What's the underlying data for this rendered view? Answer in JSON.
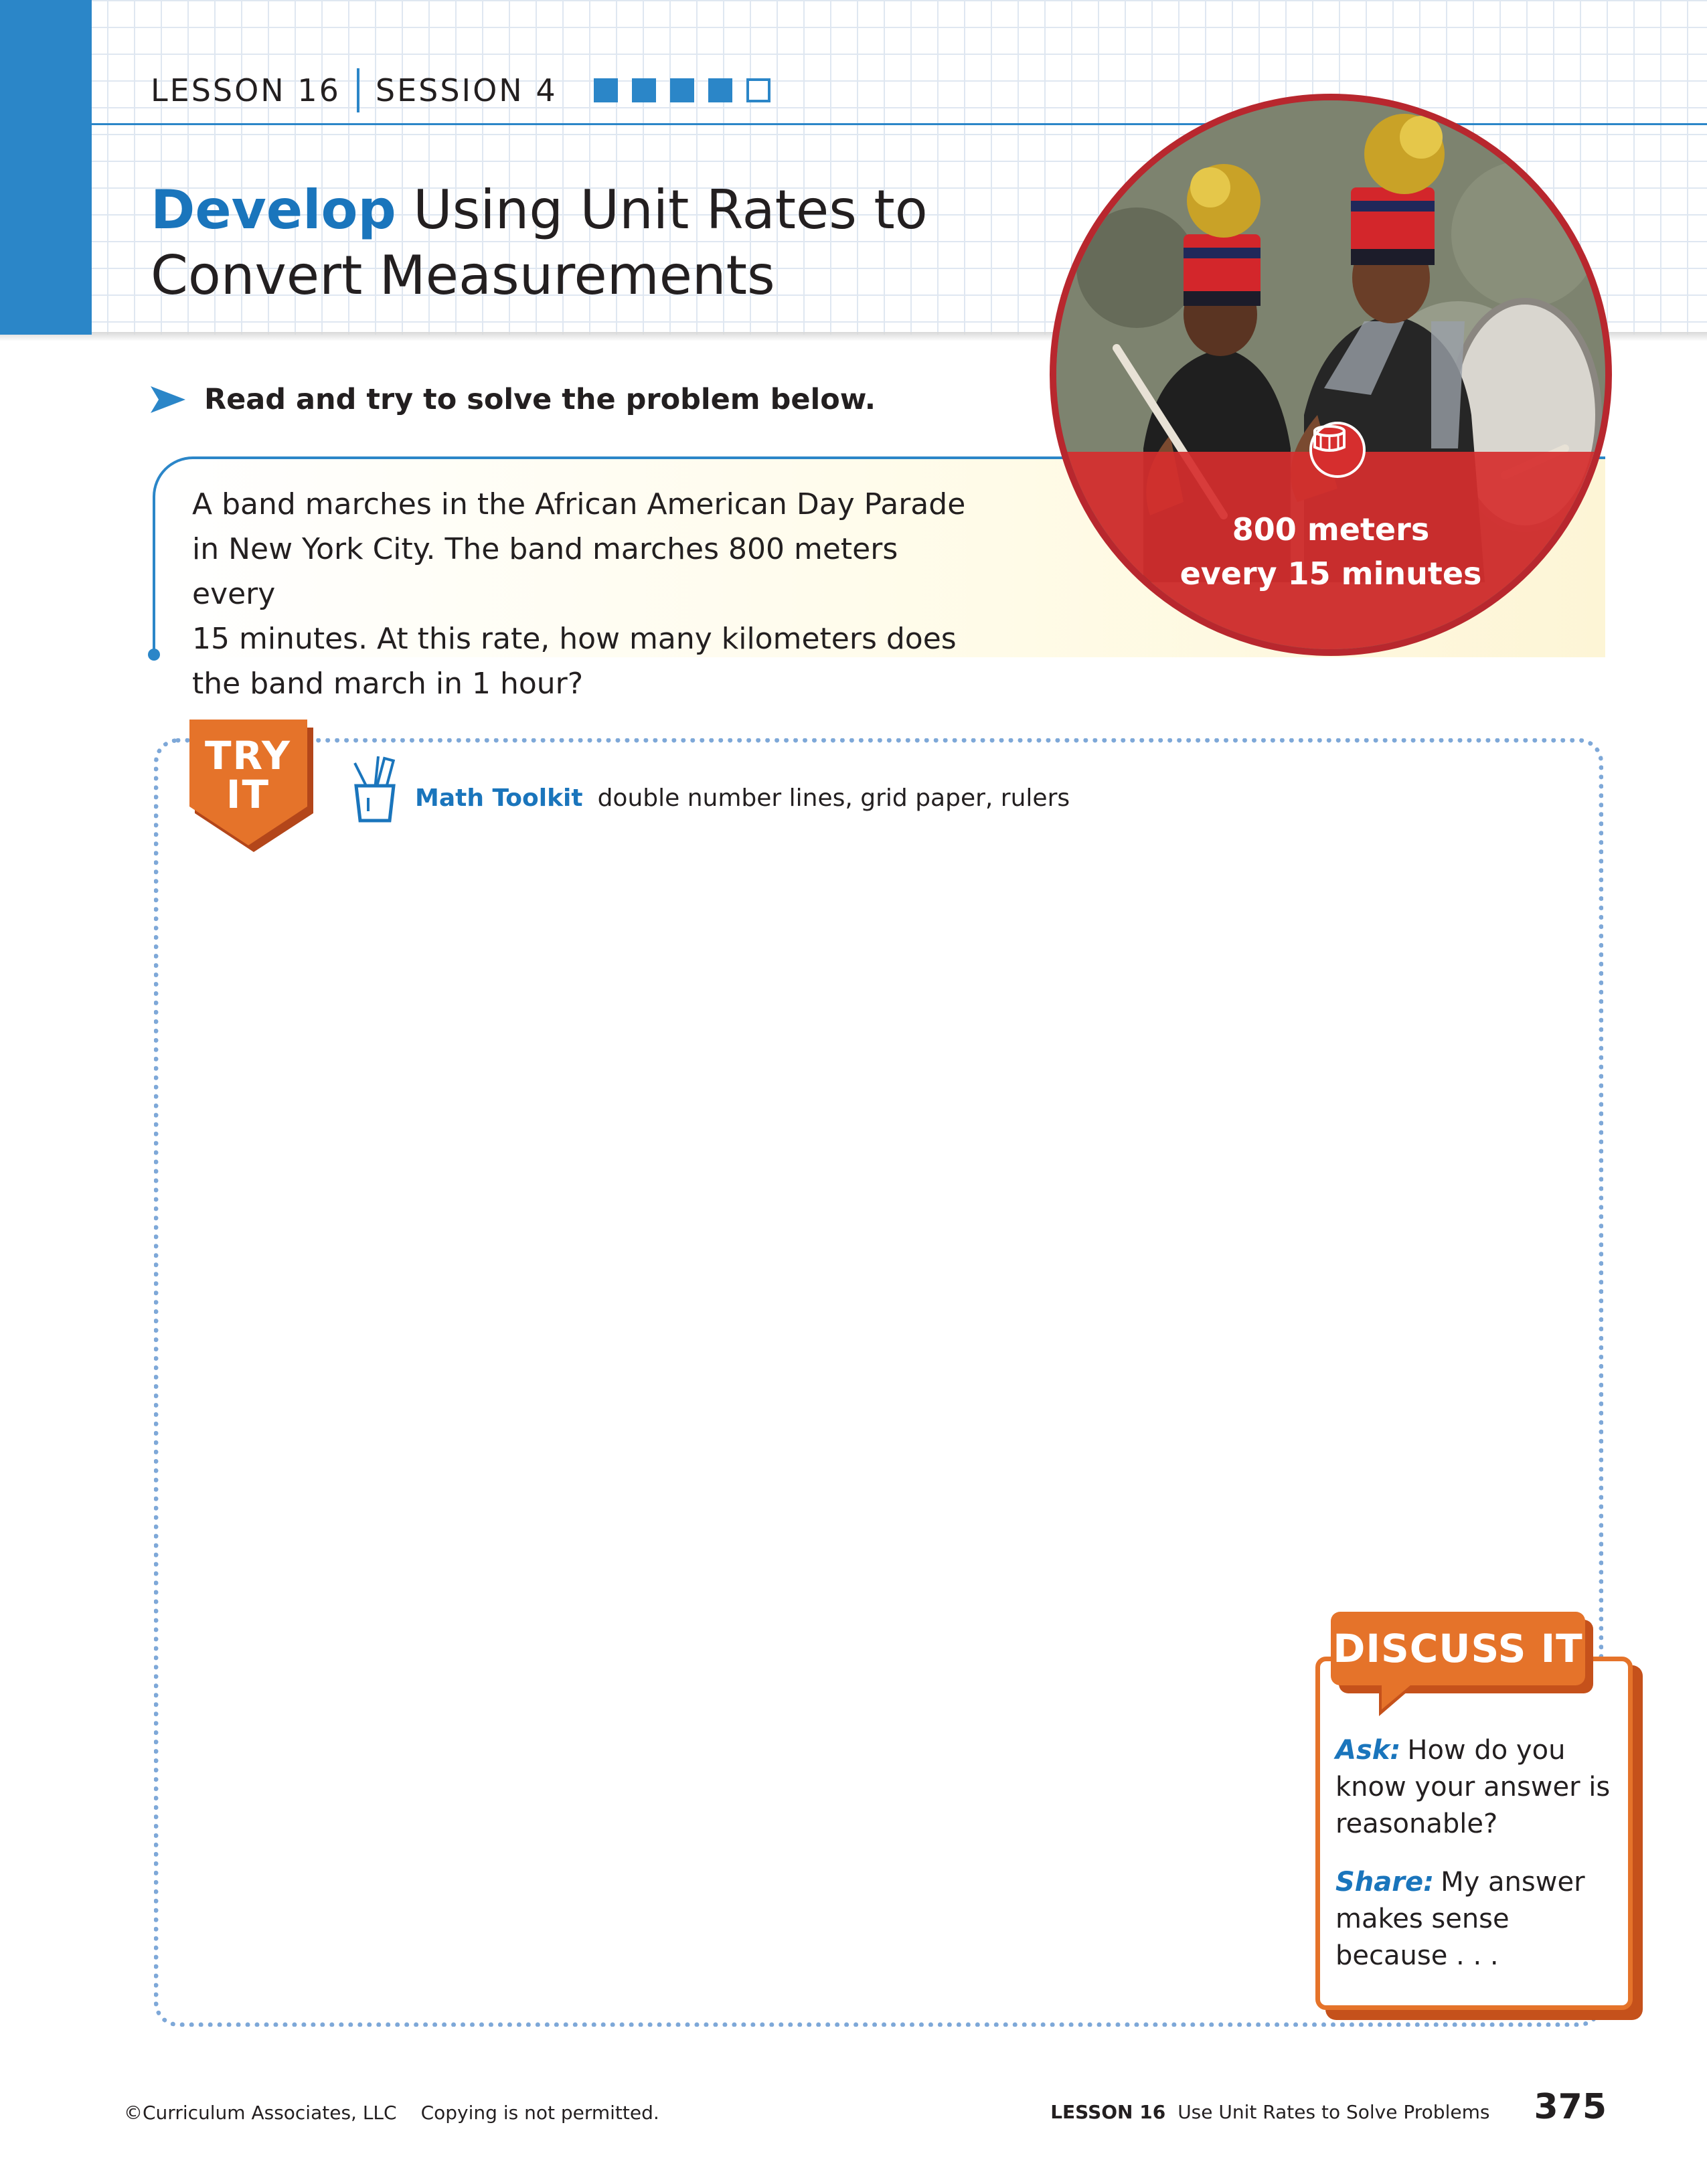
{
  "header": {
    "lesson": "LESSON 16",
    "session": "SESSION 4",
    "progress": {
      "completed": 4,
      "total": 5
    },
    "title_keyword": "Develop",
    "title_rest_line1": "Using Unit Rates to",
    "title_rest_line2": "Convert Measurements"
  },
  "photo": {
    "caption_line1": "800 meters",
    "caption_line2": "every 15 minutes",
    "icon": "drum-icon"
  },
  "instruction": {
    "icon": "arrow-right-icon",
    "text": "Read and try to solve the problem below."
  },
  "problem": {
    "line1": "A band marches in the African American Day Parade",
    "line2": "in New York City. The band marches 800 meters every",
    "line3": "15 minutes. At this rate, how many kilometers does",
    "line4": "the band march in 1 hour?"
  },
  "try_it": {
    "badge_line1": "TRY",
    "badge_line2": "IT",
    "toolkit_icon": "pencil-cup-icon",
    "toolkit_label": "Math Toolkit",
    "toolkit_items": "double number lines, grid paper, rulers"
  },
  "discuss_it": {
    "tab_label": "DISCUSS IT",
    "ask_label": "Ask:",
    "ask_text": "How do you know your answer is reasonable?",
    "share_label": "Share:",
    "share_text": "My answer makes sense because . . ."
  },
  "footer": {
    "copyright": "©Curriculum Associates, LLC",
    "notice": "Copying is not permitted.",
    "lesson": "LESSON 16",
    "topic": "Use Unit Rates to Solve Problems",
    "page_number": "375"
  },
  "colors": {
    "brand_blue": "#2b86c8",
    "title_blue": "#1a75bc",
    "orange": "#e5732a",
    "photo_red": "#d62e2e"
  }
}
